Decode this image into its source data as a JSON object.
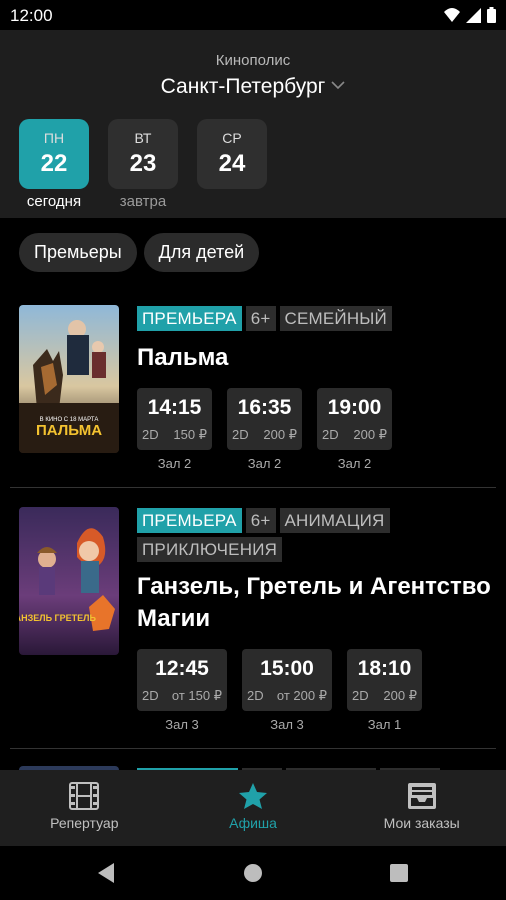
{
  "status": {
    "time": "12:00"
  },
  "header": {
    "brand": "Кинополис",
    "city": "Санкт-Петербург"
  },
  "days": [
    {
      "dow": "ПН",
      "num": "22",
      "caption": "сегодня"
    },
    {
      "dow": "ВТ",
      "num": "23",
      "caption": "завтра"
    },
    {
      "dow": "СР",
      "num": "24",
      "caption": ""
    }
  ],
  "filters": [
    "Премьеры",
    "Для детей"
  ],
  "movies": [
    {
      "tags": [
        "ПРЕМЬЕРА",
        "6+",
        "СЕМЕЙНЫЙ"
      ],
      "title": "Пальма",
      "poster_text": "ПАЛЬМА",
      "sessions": [
        {
          "time": "14:15",
          "format": "2D",
          "price": "150 ₽",
          "hall": "Зал 2"
        },
        {
          "time": "16:35",
          "format": "2D",
          "price": "200 ₽",
          "hall": "Зал 2"
        },
        {
          "time": "19:00",
          "format": "2D",
          "price": "200 ₽",
          "hall": "Зал 2"
        }
      ]
    },
    {
      "tags": [
        "ПРЕМЬЕРА",
        "6+",
        "АНИМАЦИЯ",
        "ПРИКЛЮЧЕНИЯ"
      ],
      "title": "Ганзель, Гретель и Агентство Магии",
      "poster_text": "ГАНЗЕЛЬ ГРЕТЕЛЬ",
      "sessions": [
        {
          "time": "12:45",
          "format": "2D",
          "price": "от 150 ₽",
          "hall": "Зал 3"
        },
        {
          "time": "15:00",
          "format": "2D",
          "price": "от 200 ₽",
          "hall": "Зал 3"
        },
        {
          "time": "18:10",
          "format": "2D",
          "price": "200 ₽",
          "hall": "Зал 1"
        }
      ]
    }
  ],
  "nav": [
    {
      "label": "Репертуар",
      "icon": "film-icon"
    },
    {
      "label": "Афиша",
      "icon": "star-icon"
    },
    {
      "label": "Мои заказы",
      "icon": "inbox-icon"
    }
  ],
  "colors": {
    "accent": "#20a1a9",
    "surface": "#1e1e1e",
    "chip": "#2b2b2b"
  }
}
